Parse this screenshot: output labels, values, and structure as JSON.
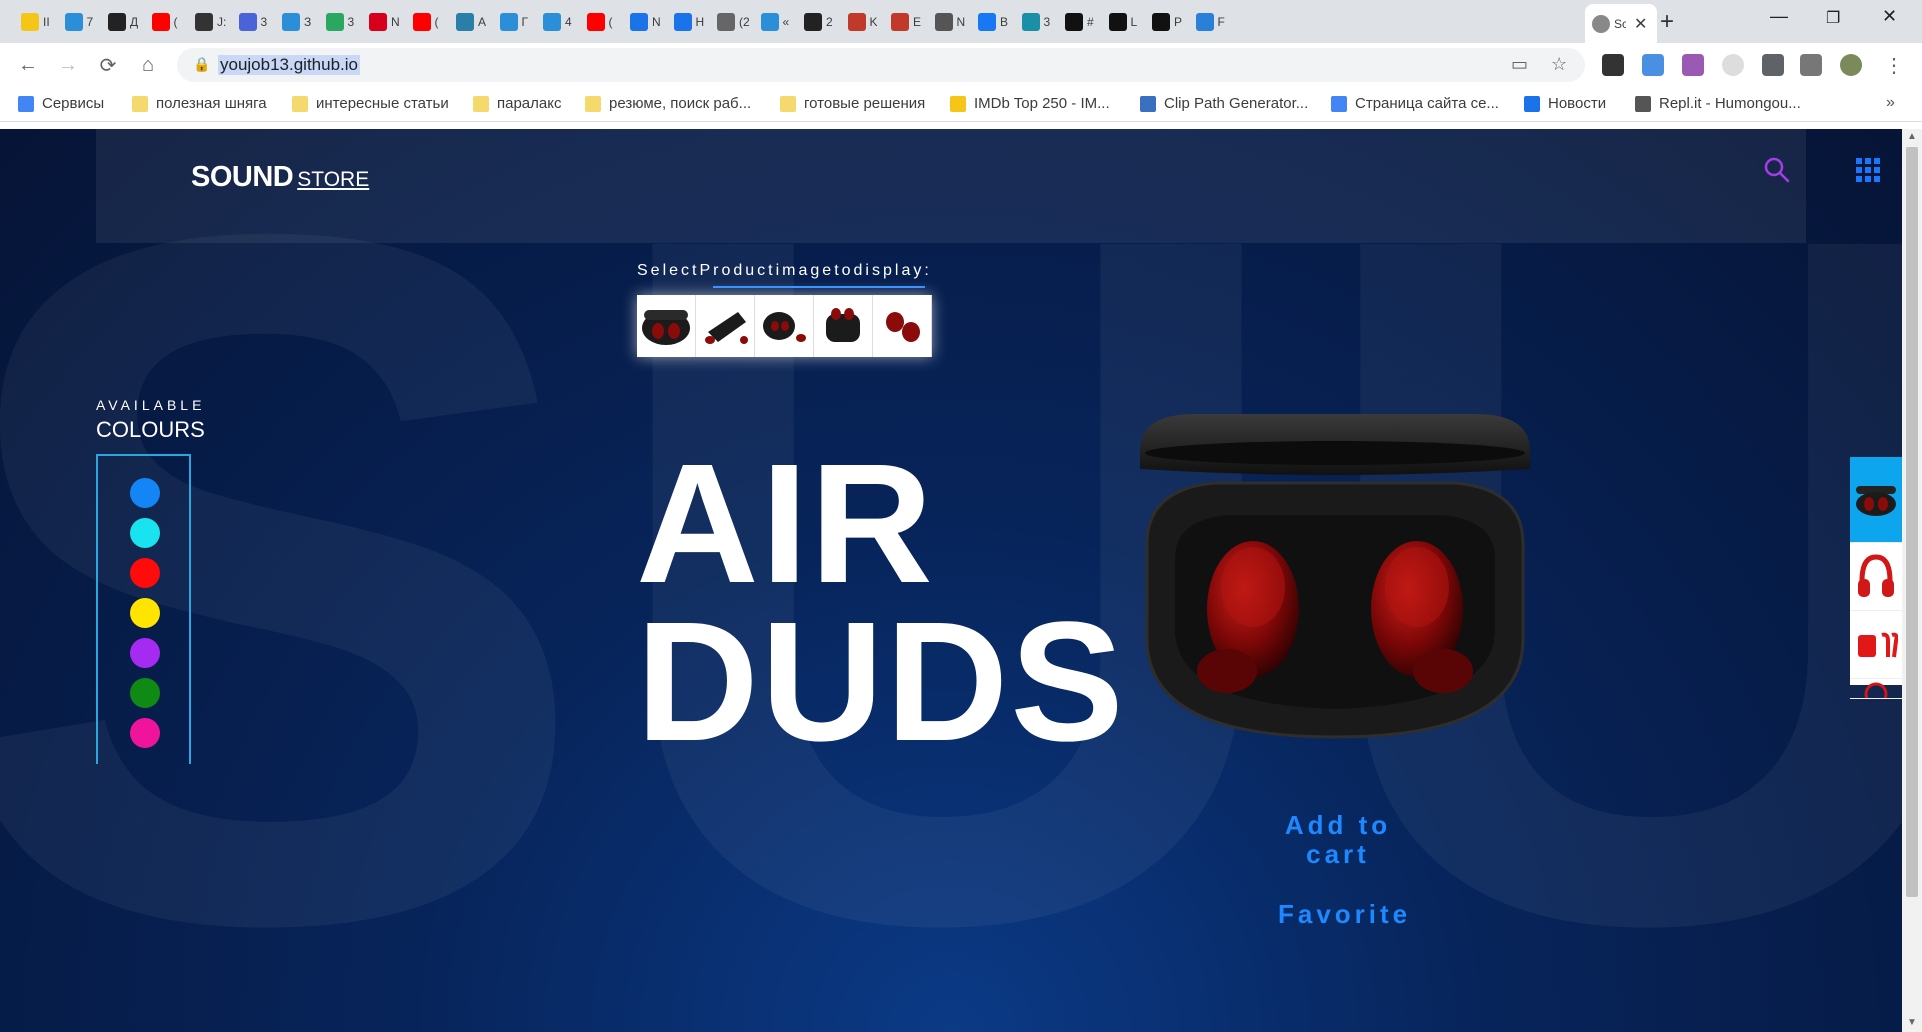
{
  "browser": {
    "tabs": [
      {
        "icon": "imdb-icon",
        "color": "#f5c518",
        "label": "II"
      },
      {
        "icon": "app-icon",
        "color": "#2a8fd8",
        "label": "7"
      },
      {
        "icon": "doc-icon",
        "color": "#222222",
        "label": "Д"
      },
      {
        "icon": "youtube-icon",
        "color": "#ff0000",
        "label": "("
      },
      {
        "icon": "pen-icon",
        "color": "#333333",
        "label": "J:"
      },
      {
        "icon": "app-icon",
        "color": "#4a63d8",
        "label": "3"
      },
      {
        "icon": "app-icon",
        "color": "#2a8fd8",
        "label": "З"
      },
      {
        "icon": "app-icon",
        "color": "#2aa860",
        "label": "3"
      },
      {
        "icon": "hh-icon",
        "color": "#d6001c",
        "label": "N"
      },
      {
        "icon": "youtube-icon",
        "color": "#ff0000",
        "label": "("
      },
      {
        "icon": "react-icon",
        "color": "#2a7fa8",
        "label": "A"
      },
      {
        "icon": "app-icon",
        "color": "#2a8fd8",
        "label": "Г"
      },
      {
        "icon": "app-icon",
        "color": "#2a8fd8",
        "label": "4"
      },
      {
        "icon": "youtube-icon",
        "color": "#ff0000",
        "label": "("
      },
      {
        "icon": "chat-icon",
        "color": "#1a73e8",
        "label": "N"
      },
      {
        "icon": "loader-icon",
        "color": "#1a73e8",
        "label": "H"
      },
      {
        "icon": "audio-icon",
        "color": "#666666",
        "label": "(2"
      },
      {
        "icon": "app-icon",
        "color": "#2a8fd8",
        "label": "«"
      },
      {
        "icon": "yc-icon",
        "color": "#222222",
        "label": "2"
      },
      {
        "icon": "hash-icon",
        "color": "#c0392b",
        "label": "K"
      },
      {
        "icon": "hash-icon",
        "color": "#c0392b",
        "label": "E"
      },
      {
        "icon": "github-icon",
        "color": "#555555",
        "label": "N"
      },
      {
        "icon": "f-icon",
        "color": "#1877f2",
        "label": "B"
      },
      {
        "icon": "app-icon",
        "color": "#1a8fa8",
        "label": "3"
      },
      {
        "icon": "codepen-icon",
        "color": "#111111",
        "label": "#"
      },
      {
        "icon": "codepen-icon",
        "color": "#111111",
        "label": "L"
      },
      {
        "icon": "codepen-icon",
        "color": "#111111",
        "label": "P"
      },
      {
        "icon": "s-icon",
        "color": "#2a7fd8",
        "label": "F"
      }
    ],
    "active_tab": {
      "icon": "sound-icon",
      "color": "#888888",
      "label": "Sc"
    },
    "url": "youjob13.github.io",
    "bookmarks": [
      {
        "icon": "apps-icon",
        "label": "Сервисы"
      },
      {
        "icon": "folder-icon",
        "label": "полезная шняга"
      },
      {
        "icon": "folder-icon",
        "label": "интересные статьи"
      },
      {
        "icon": "folder-icon",
        "label": "паралакс"
      },
      {
        "icon": "folder-icon",
        "label": "резюме, поиск раб..."
      },
      {
        "icon": "folder-icon",
        "label": "готовые решения"
      },
      {
        "icon": "imdb-icon",
        "label": "IMDb Top 250 - IM..."
      },
      {
        "icon": "clippath-icon",
        "label": "Clip Path Generator..."
      },
      {
        "icon": "docs-icon",
        "label": "Страница сайта се..."
      },
      {
        "icon": "news-icon",
        "label": "Новости"
      },
      {
        "icon": "replit-icon",
        "label": "Repl.it - Humongou..."
      }
    ]
  },
  "page": {
    "logo_main": "SOUND",
    "logo_sub": "STORE",
    "select_label": "SelectProductimagetodisplay:",
    "available_label": "AVAILABLE",
    "colours_label": "COLOURS",
    "colours": [
      "#1485f5",
      "#19e3ef",
      "#ff0b0b",
      "#ffe400",
      "#a52bf2",
      "#0f8a14",
      "#f0149c"
    ],
    "title_line1": "AIR",
    "title_line2": "DUDS",
    "add_to_cart": "Add to cart",
    "favorite": "Favorite"
  }
}
